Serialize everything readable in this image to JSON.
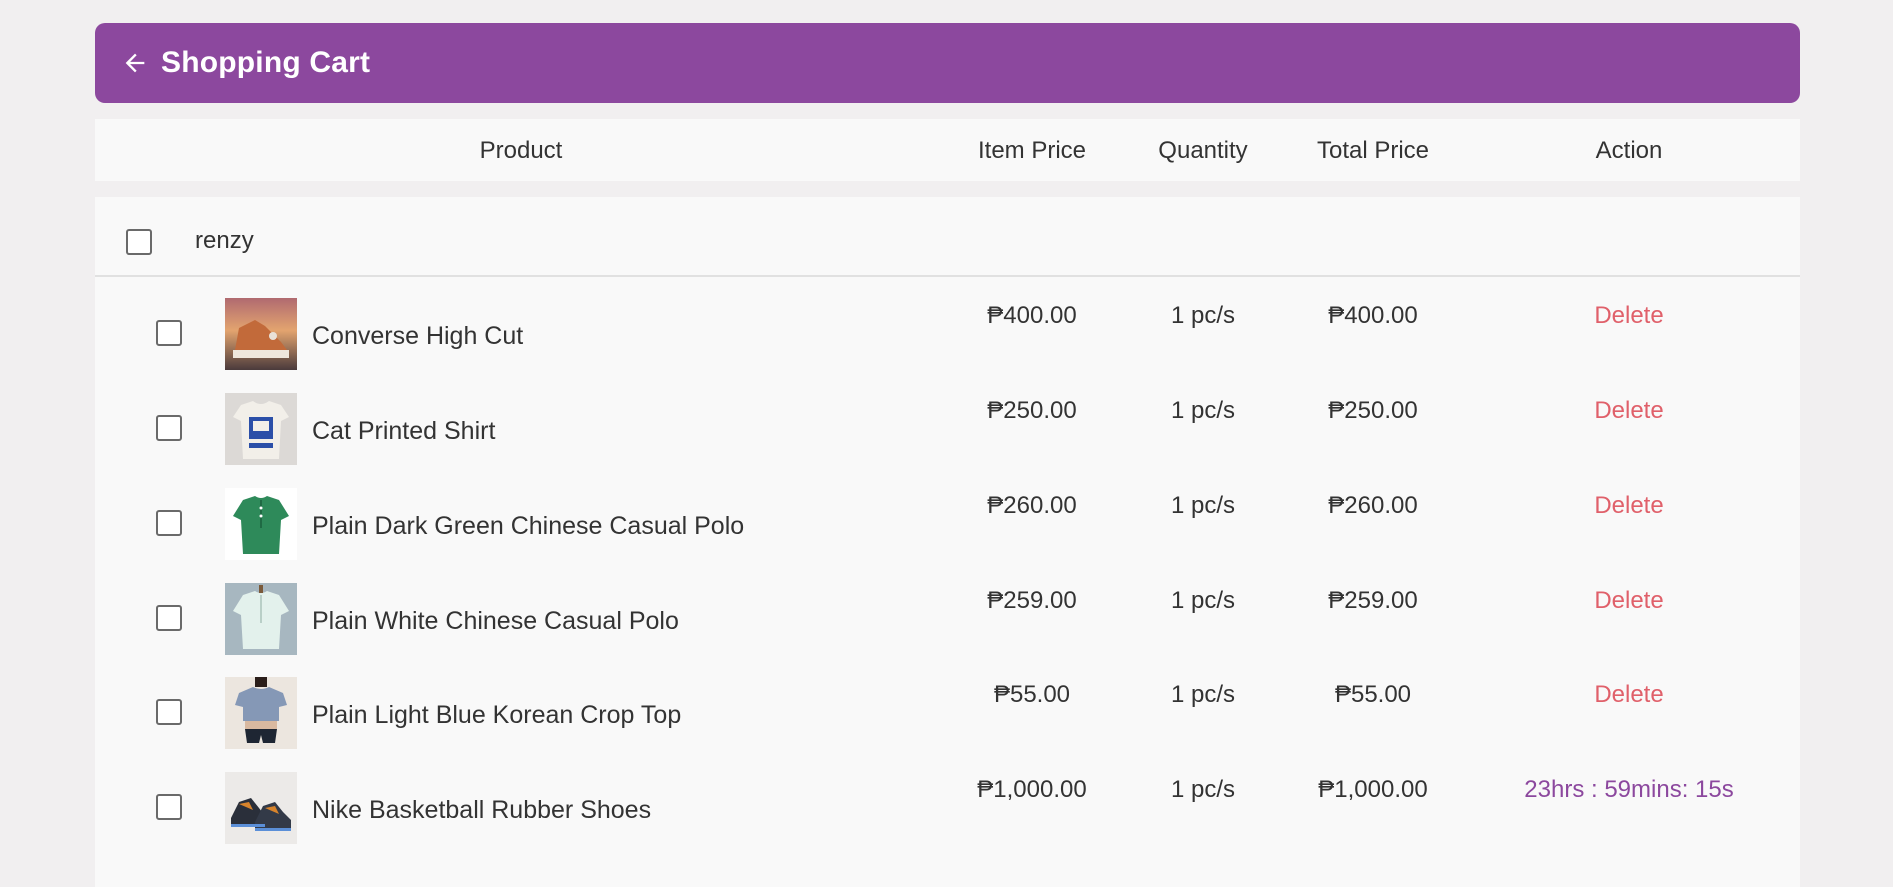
{
  "colors": {
    "accent": "#8c489e",
    "delete": "#e0606a"
  },
  "header": {
    "title": "Shopping Cart",
    "back_icon": "arrow-left-icon"
  },
  "columns": {
    "product": "Product",
    "item_price": "Item Price",
    "quantity": "Quantity",
    "total_price": "Total Price",
    "action": "Action"
  },
  "shop": {
    "name": "renzy",
    "checked": false
  },
  "items": [
    {
      "name": "Converse High Cut",
      "item_price": "₱400.00",
      "quantity": "1 pc/s",
      "total_price": "₱400.00",
      "action": "Delete",
      "checked": false
    },
    {
      "name": "Cat Printed Shirt",
      "item_price": "₱250.00",
      "quantity": "1 pc/s",
      "total_price": "₱250.00",
      "action": "Delete",
      "checked": false
    },
    {
      "name": "Plain Dark Green Chinese Casual Polo",
      "item_price": "₱260.00",
      "quantity": "1 pc/s",
      "total_price": "₱260.00",
      "action": "Delete",
      "checked": false
    },
    {
      "name": "Plain White Chinese Casual Polo",
      "item_price": "₱259.00",
      "quantity": "1 pc/s",
      "total_price": "₱259.00",
      "action": "Delete",
      "checked": false
    },
    {
      "name": "Plain Light Blue Korean Crop Top",
      "item_price": "₱55.00",
      "quantity": "1 pc/s",
      "total_price": "₱55.00",
      "action": "Delete",
      "checked": false
    },
    {
      "name": "Nike Basketball Rubber Shoes",
      "item_price": "₱1,000.00",
      "quantity": "1 pc/s",
      "total_price": "₱1,000.00",
      "action": "23hrs : 59mins: 15s",
      "checked": false
    }
  ]
}
